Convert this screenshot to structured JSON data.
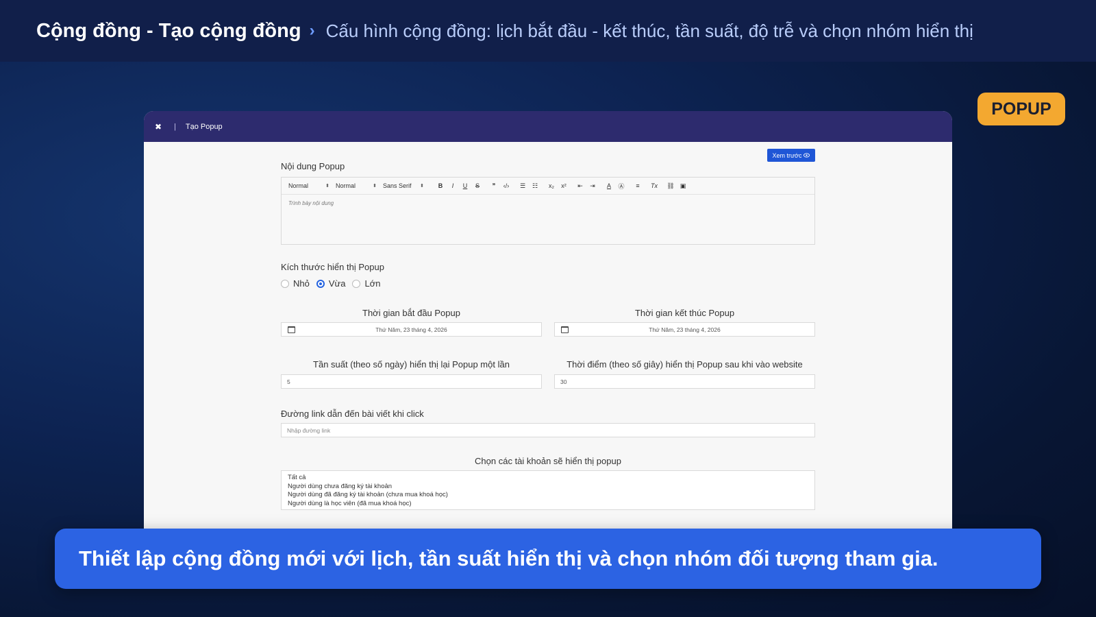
{
  "header": {
    "title": "Cộng đồng - Tạo cộng đồng",
    "separator": "›",
    "subtitle": "Cấu hình cộng đồng: lịch bắt đầu - kết thúc, tần suất, độ trễ và chọn nhóm hiển thị"
  },
  "badge": "POPUP",
  "window": {
    "close_icon": "✖",
    "divider": "|",
    "title": "Tạo Popup"
  },
  "preview_button": {
    "label": "Xem trước",
    "icon": "eye-icon"
  },
  "content_section": {
    "label": "Nội dung Popup",
    "toolbar": {
      "header_select": "Normal",
      "size_select": "Normal",
      "font_select": "Sans Serif",
      "buttons": [
        "B",
        "I",
        "U",
        "S",
        "❝",
        "</>",
        "ordered-list",
        "bullet-list",
        "X₂",
        "X²",
        "indent-left",
        "indent-right",
        "A",
        "A-bg",
        "align",
        "Tx",
        "link",
        "image"
      ]
    },
    "editor_placeholder": "Trình bày nội dung"
  },
  "size_section": {
    "label": "Kích thước hiển thị Popup",
    "options": [
      {
        "label": "Nhỏ",
        "selected": false
      },
      {
        "label": "Vừa",
        "selected": true
      },
      {
        "label": "Lớn",
        "selected": false
      }
    ]
  },
  "start_time": {
    "label": "Thời gian bắt đầu Popup",
    "value": "Thứ Năm, 23 tháng 4, 2026"
  },
  "end_time": {
    "label": "Thời gian kết thúc Popup",
    "value": "Thứ Năm, 23 tháng 4, 2026"
  },
  "frequency": {
    "label": "Tần suất (theo số ngày) hiển thị lại Popup một lần",
    "value": "5"
  },
  "delay": {
    "label": "Thời điểm (theo số giây) hiển thị Popup sau khi vào website",
    "value": "30"
  },
  "link": {
    "label": "Đường link dẫn đến bài viết khi click",
    "placeholder": "Nhập đường link"
  },
  "accounts": {
    "label": "Chọn các tài khoản sẽ hiển thị popup",
    "options": [
      "Tất cả",
      "Người dùng chưa đăng ký tài khoản",
      "Người dùng đã đăng ký tài khoản (chưa mua khoá học)",
      "Người dùng là học viên (đã mua khoá học)"
    ]
  },
  "caption": "Thiết lập cộng đồng mới với lịch, tần suất hiển thị và chọn nhóm đối tượng tham gia.",
  "colors": {
    "background": "#0d2352",
    "topbar": "#111f4a",
    "window_header": "#2d2b6e",
    "accent_blue": "#2c63e3",
    "badge": "#f3a830"
  }
}
